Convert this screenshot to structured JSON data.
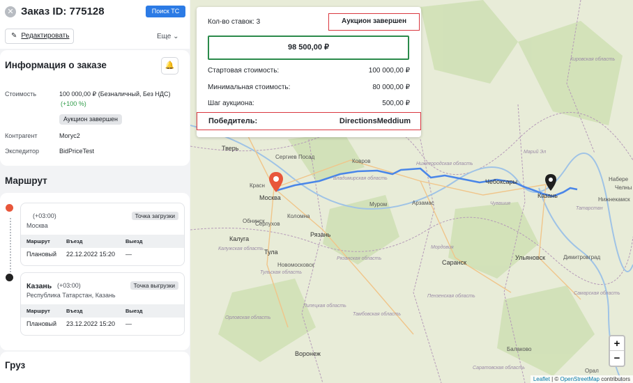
{
  "header": {
    "title": "Заказ ID: 775128",
    "search_transport": "Поиск ТС",
    "edit": "Редактировать",
    "more": "Еще"
  },
  "order_info": {
    "title": "Информация о заказе",
    "cost_label": "Стоимость",
    "cost_value": "100 000,00 ₽ (Безналичный, Без НДС)",
    "cost_delta": "(+100 %)",
    "status_badge": "Аукцион завершен",
    "counterparty_label": "Контрагент",
    "counterparty_value": "Могус2",
    "forwarder_label": "Экспедитор",
    "forwarder_value": "BidPriceTest"
  },
  "route": {
    "title": "Маршрут",
    "stops": [
      {
        "city": "",
        "tz": "(+03:00)",
        "sub": "Москва",
        "tag": "Точка загрузки",
        "col_route": "Маршрут",
        "col_depart": "Въезд",
        "col_exit": "Выезд",
        "row_type": "Плановый",
        "row_date": "22.12.2022 15:20",
        "row_exit": "—"
      },
      {
        "city": "Казань",
        "tz": "(+03:00)",
        "sub": "Республика Татарстан, Казань",
        "tag": "Точка выгрузки",
        "col_route": "Маршрут",
        "col_depart": "Въезд",
        "col_exit": "Выезд",
        "row_type": "Плановый",
        "row_date": "23.12.2022 15:20",
        "row_exit": "—"
      }
    ]
  },
  "cargo": {
    "title": "Груз"
  },
  "auction": {
    "bids_count": "Кол-во ставок: 3",
    "status": "Аукцион завершен",
    "current_price": "98 500,00 ₽",
    "start_label": "Стартовая стоимость:",
    "start_value": "100 000,00 ₽",
    "min_label": "Минимальная стоимость:",
    "min_value": "80 000,00 ₽",
    "step_label": "Шаг аукциона:",
    "step_value": "500,00 ₽",
    "winner_label": "Победитель:",
    "winner_value": "DirectionsMeddium"
  },
  "map": {
    "cities": {
      "tver": "Тверь",
      "moscow": "Москва",
      "sergiev": "Сергиев Посад",
      "kovrov": "Ковров",
      "murom": "Муром",
      "arzamas": "Арзамас",
      "cheboksary": "Чебоксары",
      "kazan": "Казань",
      "obninsk": "Обнинск",
      "serpukhov": "Серпухов",
      "kolomna": "Коломна",
      "kaluga": "Калуга",
      "ryazan": "Рязань",
      "tula": "Тула",
      "novomoskovsk": "Новомосковск",
      "saransk": "Саранск",
      "ulyanovsk": "Ульяновск",
      "dimitrovgrad": "Димитровград",
      "voronezh": "Воронеж",
      "balakovo": "Балаково",
      "krasn": "Красн",
      "naberezh": "Набере",
      "chelny": "Челны",
      "nizhnekamsk": "Нижнекамск",
      "oral": "Орал"
    },
    "regions": {
      "kirov": "Кировская область",
      "nizhny": "Нижегородская область",
      "vladimir": "Владимирская область",
      "chuvash": "Чувашия",
      "tatarstan": "Татарстан",
      "mordovia": "Мордовия",
      "penza": "Пензенская область",
      "tambov": "Тамбовская область",
      "lipetsk": "Липецкая область",
      "samara": "Самарская область",
      "saratov": "Саратовская область",
      "ryazan_obl": "Рязанская область",
      "tula_obl": "Тульская область",
      "kaluga_obl": "Калужская область",
      "orel": "Орловская область",
      "mari": "Марий Эл"
    },
    "zoom_in": "+",
    "zoom_out": "−",
    "attr_leaflet": "Leaflet",
    "attr_sep": " | © ",
    "attr_osm": "OpenStreetMap",
    "attr_tail": " contributors"
  },
  "colors": {
    "accent": "#2c7be5",
    "route_line": "#4a86e8",
    "alert": "#d9363e",
    "success": "#2a8a4a"
  }
}
